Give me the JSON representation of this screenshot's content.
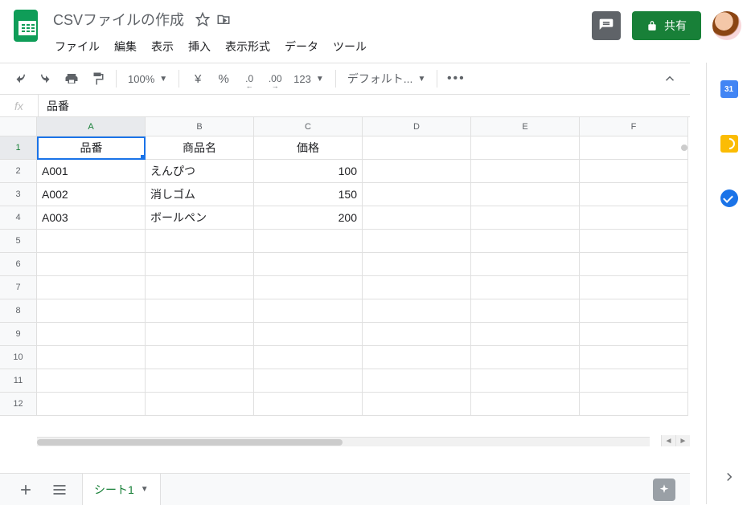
{
  "header": {
    "doc_title": "CSVファイルの作成",
    "share_label": "共有"
  },
  "menubar": {
    "items": [
      "ファイル",
      "編集",
      "表示",
      "挿入",
      "表示形式",
      "データ",
      "ツール"
    ]
  },
  "toolbar": {
    "zoom": "100%",
    "currency": "¥",
    "percent": "%",
    "dec_dec": ".0",
    "inc_dec": ".00",
    "format_123": "123",
    "font": "デフォルト..."
  },
  "formula_bar": {
    "fx": "fx",
    "value": "品番"
  },
  "grid": {
    "columns": [
      "A",
      "B",
      "C",
      "D",
      "E",
      "F"
    ],
    "active_cell": {
      "row": 1,
      "col": 0
    },
    "rows": [
      {
        "n": 1,
        "cells": [
          {
            "v": "品番",
            "a": "center"
          },
          {
            "v": "商品名",
            "a": "center"
          },
          {
            "v": "価格",
            "a": "center"
          },
          {
            "v": ""
          },
          {
            "v": ""
          },
          {
            "v": ""
          }
        ]
      },
      {
        "n": 2,
        "cells": [
          {
            "v": "A001"
          },
          {
            "v": "えんぴつ"
          },
          {
            "v": "100",
            "a": "right"
          },
          {
            "v": ""
          },
          {
            "v": ""
          },
          {
            "v": ""
          }
        ]
      },
      {
        "n": 3,
        "cells": [
          {
            "v": "A002"
          },
          {
            "v": "消しゴム"
          },
          {
            "v": "150",
            "a": "right"
          },
          {
            "v": ""
          },
          {
            "v": ""
          },
          {
            "v": ""
          }
        ]
      },
      {
        "n": 4,
        "cells": [
          {
            "v": "A003"
          },
          {
            "v": "ボールペン"
          },
          {
            "v": "200",
            "a": "right"
          },
          {
            "v": ""
          },
          {
            "v": ""
          },
          {
            "v": ""
          }
        ]
      },
      {
        "n": 5,
        "cells": [
          {
            "v": ""
          },
          {
            "v": ""
          },
          {
            "v": ""
          },
          {
            "v": ""
          },
          {
            "v": ""
          },
          {
            "v": ""
          }
        ]
      },
      {
        "n": 6,
        "cells": [
          {
            "v": ""
          },
          {
            "v": ""
          },
          {
            "v": ""
          },
          {
            "v": ""
          },
          {
            "v": ""
          },
          {
            "v": ""
          }
        ]
      },
      {
        "n": 7,
        "cells": [
          {
            "v": ""
          },
          {
            "v": ""
          },
          {
            "v": ""
          },
          {
            "v": ""
          },
          {
            "v": ""
          },
          {
            "v": ""
          }
        ]
      },
      {
        "n": 8,
        "cells": [
          {
            "v": ""
          },
          {
            "v": ""
          },
          {
            "v": ""
          },
          {
            "v": ""
          },
          {
            "v": ""
          },
          {
            "v": ""
          }
        ]
      },
      {
        "n": 9,
        "cells": [
          {
            "v": ""
          },
          {
            "v": ""
          },
          {
            "v": ""
          },
          {
            "v": ""
          },
          {
            "v": ""
          },
          {
            "v": ""
          }
        ]
      },
      {
        "n": 10,
        "cells": [
          {
            "v": ""
          },
          {
            "v": ""
          },
          {
            "v": ""
          },
          {
            "v": ""
          },
          {
            "v": ""
          },
          {
            "v": ""
          }
        ]
      },
      {
        "n": 11,
        "cells": [
          {
            "v": ""
          },
          {
            "v": ""
          },
          {
            "v": ""
          },
          {
            "v": ""
          },
          {
            "v": ""
          },
          {
            "v": ""
          }
        ]
      },
      {
        "n": 12,
        "cells": [
          {
            "v": ""
          },
          {
            "v": ""
          },
          {
            "v": ""
          },
          {
            "v": ""
          },
          {
            "v": ""
          },
          {
            "v": ""
          }
        ]
      }
    ]
  },
  "sheet_bar": {
    "tab_name": "シート1"
  },
  "side_panel": {
    "calendar_day": "31"
  }
}
